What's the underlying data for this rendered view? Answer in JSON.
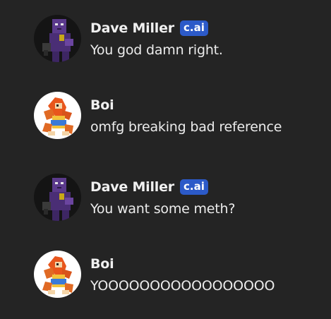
{
  "messages": [
    {
      "author": "Dave Miller",
      "badge": "c.ai",
      "text": "You god damn right.",
      "avatar": "purple-guy-avatar"
    },
    {
      "author": "Boi",
      "text": "omfg breaking bad reference",
      "avatar": "monkey-avatar"
    },
    {
      "author": "Dave Miller",
      "badge": "c.ai",
      "text": "You want some meth?",
      "avatar": "purple-guy-avatar"
    },
    {
      "author": "Boi",
      "text": "YOOOOOOOOOOOOOOOOO",
      "avatar": "monkey-avatar"
    }
  ],
  "colors": {
    "background": "#242424",
    "badge": "#2c5ac8",
    "text": "#ececec"
  }
}
